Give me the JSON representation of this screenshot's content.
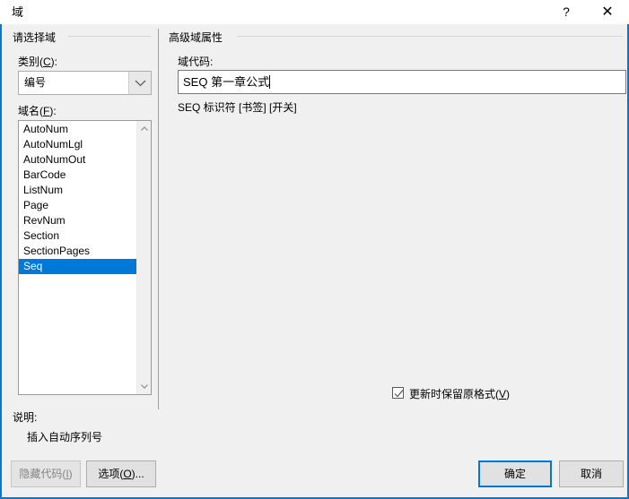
{
  "window": {
    "title": "域",
    "help_glyph": "?",
    "close_glyph": "✕"
  },
  "colors": {
    "accent": "#0078d7",
    "window_body": "#f0f0f0",
    "titlebar": "#ffffff",
    "selection": "#0078d7",
    "button_face": "#e1e1e1",
    "disabled_text": "#838383"
  },
  "left_panel": {
    "group_label": "请选择域",
    "category": {
      "label_prefix": "类别(",
      "label_key": "C",
      "label_suffix": "):",
      "selected": "编号"
    },
    "fieldname": {
      "label_prefix": "域名(",
      "label_key": "F",
      "label_suffix": "):",
      "items": [
        "AutoNum",
        "AutoNumLgl",
        "AutoNumOut",
        "BarCode",
        "ListNum",
        "Page",
        "RevNum",
        "Section",
        "SectionPages",
        "Seq"
      ],
      "selected": "Seq",
      "selected_index": 9
    }
  },
  "right_panel": {
    "group_label": "高级域属性",
    "fieldcode": {
      "label": "域代码:",
      "value": "SEQ 第一章公式",
      "hint": "SEQ 标识符 [书签] [开关]"
    },
    "preserve_format": {
      "label_prefix": "更新时保留原格式(",
      "label_key": "V",
      "label_suffix": ")",
      "checked": true
    }
  },
  "description": {
    "label": "说明:",
    "value": "插入自动序列号"
  },
  "buttons": {
    "hide_code": {
      "label_prefix": "隐藏代码(",
      "label_key": "I",
      "label_suffix": ")",
      "enabled": false
    },
    "options": {
      "label_prefix": "选项(",
      "label_key": "O",
      "label_suffix": ")...",
      "enabled": true
    },
    "ok": {
      "label": "确定",
      "is_default": true
    },
    "cancel": {
      "label": "取消"
    }
  }
}
